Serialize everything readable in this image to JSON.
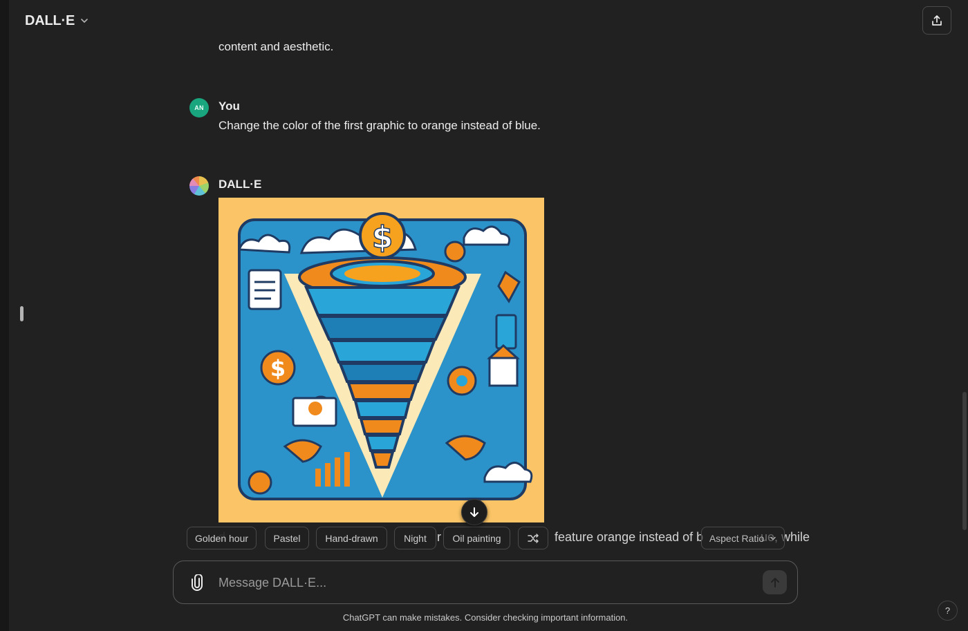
{
  "header": {
    "model_name": "DALL·E",
    "model_icon": "chevron-down-icon",
    "share_icon": "share-upload-icon"
  },
  "conversation": {
    "prev_text_tail": "content and aesthetic.",
    "user_message": {
      "avatar_initials": "AN",
      "author": "You",
      "text": "Change the color of the first graphic to orange instead of blue."
    },
    "assistant_message": {
      "author": "DALL·E",
      "avatar_icon": "dalle-color-wheel-icon",
      "image_description_icon": "generated-funnel-image",
      "text_fragments": [
        "d",
        "r",
        "feature orange instead of b",
        "ue, while"
      ]
    }
  },
  "style_chips": [
    "Golden hour",
    "Pastel",
    "Hand-drawn",
    "Night",
    "Oil painting"
  ],
  "aspect_ratio_label": "Aspect Ratio",
  "composer": {
    "placeholder": "Message DALL·E...",
    "attach_icon": "paperclip-icon",
    "send_icon": "arrow-up-icon"
  },
  "disclaimer": "ChatGPT can make mistakes. Consider checking important information.",
  "help_label": "?",
  "colors": {
    "background": "#212121",
    "user_avatar": "#19a67f",
    "image_background": "#fbc567",
    "funnel_blue": "#2aa5d8",
    "funnel_orange": "#f08a1c"
  }
}
